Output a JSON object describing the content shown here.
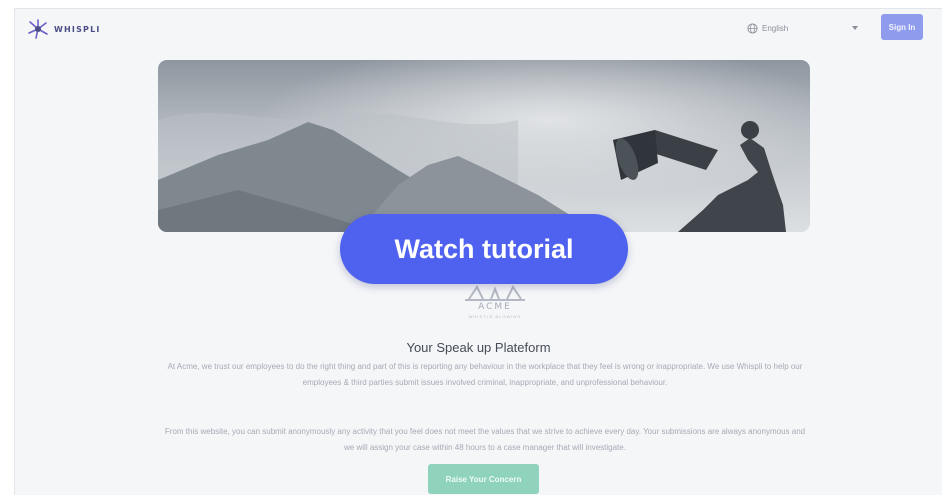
{
  "app": {
    "brand": "WHISPLI",
    "accent": "#4f62ef"
  },
  "header": {
    "language": {
      "selected": "English",
      "icon": "globe-icon"
    },
    "signin_label": "Sign In"
  },
  "overlay": {
    "tutorial_label": "Watch tutorial"
  },
  "company": {
    "name": "ACME",
    "tagline": "WHISTLE BLOWING"
  },
  "main": {
    "title": "Your Speak up Plateform",
    "paragraph1": "At Acme, we trust our employees to do the right thing and part of this is reporting any behaviour in the workplace that they feel is wrong or inappropriate. We use Whispli to help our employees & third parties submit issues involved criminal, inappropriate, and unprofessional behaviour.",
    "paragraph2": "From this website, you can submit anonymously any activity that you feel does not meet the values that we strive to achieve every day. Your submissions are always anonymous and we will assign your case within 48 hours to a case manager that will investigate.",
    "cta_label": "Raise Your Concern"
  }
}
